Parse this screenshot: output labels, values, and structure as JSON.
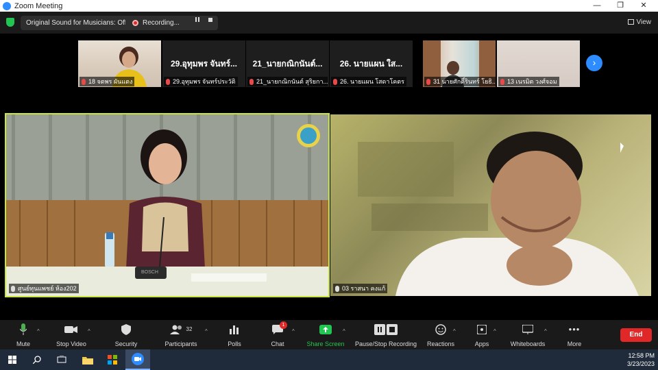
{
  "window": {
    "title": "Zoom Meeting",
    "controls": {
      "minimize": "—",
      "maximize": "❐",
      "close": "✕"
    }
  },
  "topbar": {
    "audio_pill": "Original Sound for Musicians: Off",
    "recording_label": "Recording...",
    "view_label": "View",
    "shield_color": "#23c552"
  },
  "gallery": [
    {
      "label": "18 จตพร ผันแตง"
    },
    {
      "display": "29.อุทุมพร จันทร์...",
      "label": "29.อุทุมพร จันทร์ประวัติ"
    },
    {
      "display": "21_นายกณิกนันต์...",
      "label": "21_นายกณิกนันต์ สุริยกา..."
    },
    {
      "display": "26. นายแผน ใส...",
      "label": "26. นายแผน โสดาโคตร"
    },
    {
      "label": "31 นายศักดิ์รินทร์ โยธิ..."
    },
    {
      "label": "13 เนรมิต วงศ์จอม"
    }
  ],
  "videos": {
    "left_label": "ศูนย์ทุนแพชย์ ห้อง202",
    "right_label": "03 ราสนา คงแก้",
    "active_speaker_border": "#c8e63c",
    "mic_brand": "BOSCH"
  },
  "toolbar": {
    "mute": "Mute",
    "stop_video": "Stop Video",
    "security": "Security",
    "participants": "Participants",
    "participants_count": "32",
    "polls": "Polls",
    "chat": "Chat",
    "chat_badge": "1",
    "share_screen": "Share Screen",
    "pause_stop_recording": "Pause/Stop Recording",
    "reactions": "Reactions",
    "apps": "Apps",
    "whiteboards": "Whiteboards",
    "more": "More",
    "end": "End",
    "share_color": "#23c552",
    "end_color": "#e02828"
  },
  "taskbar": {
    "time": "12:58 PM",
    "date": "3/23/2023"
  }
}
